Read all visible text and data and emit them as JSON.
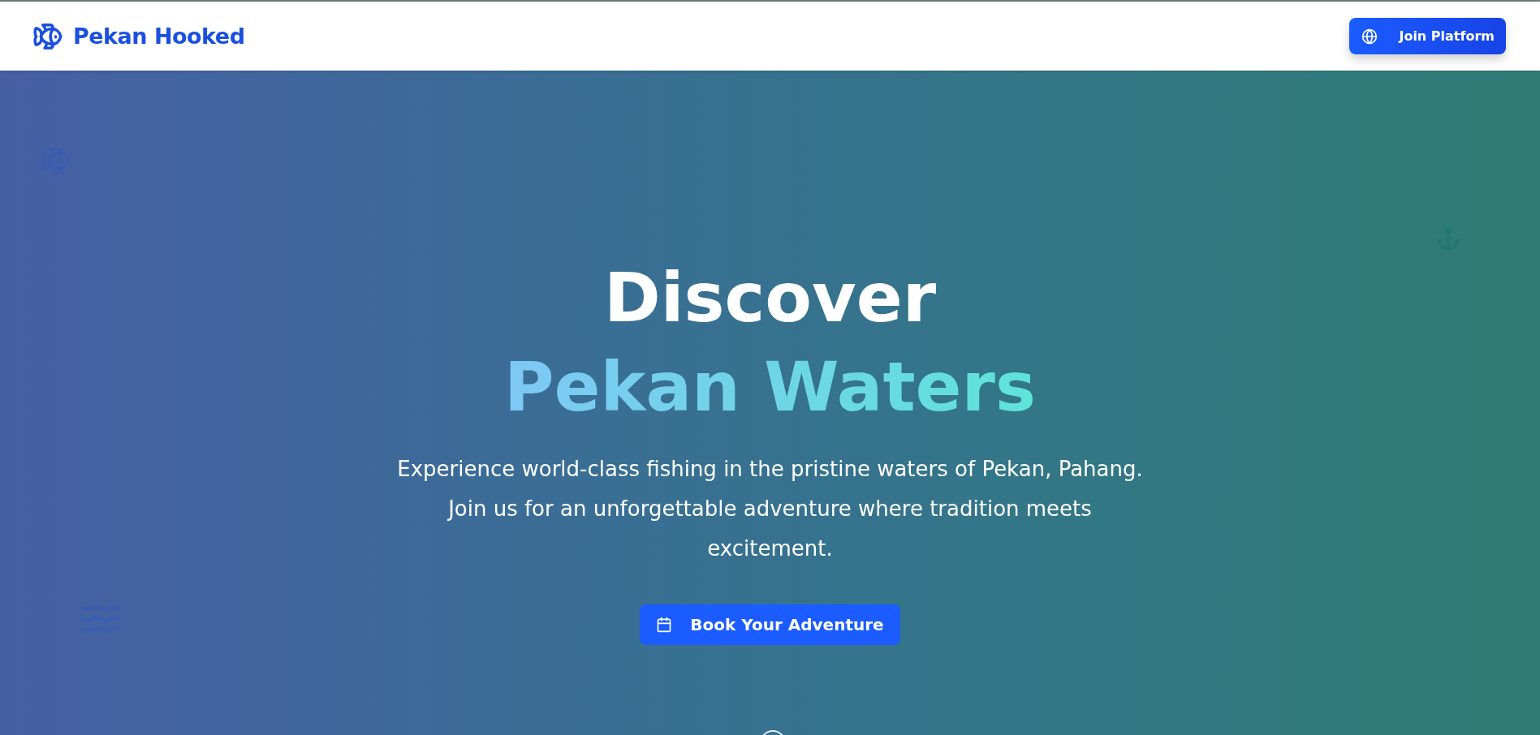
{
  "header": {
    "brand": "Pekan Hooked",
    "join_button": "Join Platform"
  },
  "hero": {
    "title_line_1": "Discover",
    "title_line_2": "Pekan Waters",
    "description": "Experience world-class fishing in the pristine waters of Pekan, Pahang. Join us for an unforgettable adventure where tradition meets excitement.",
    "cta_button": "Book Your Adventure"
  }
}
